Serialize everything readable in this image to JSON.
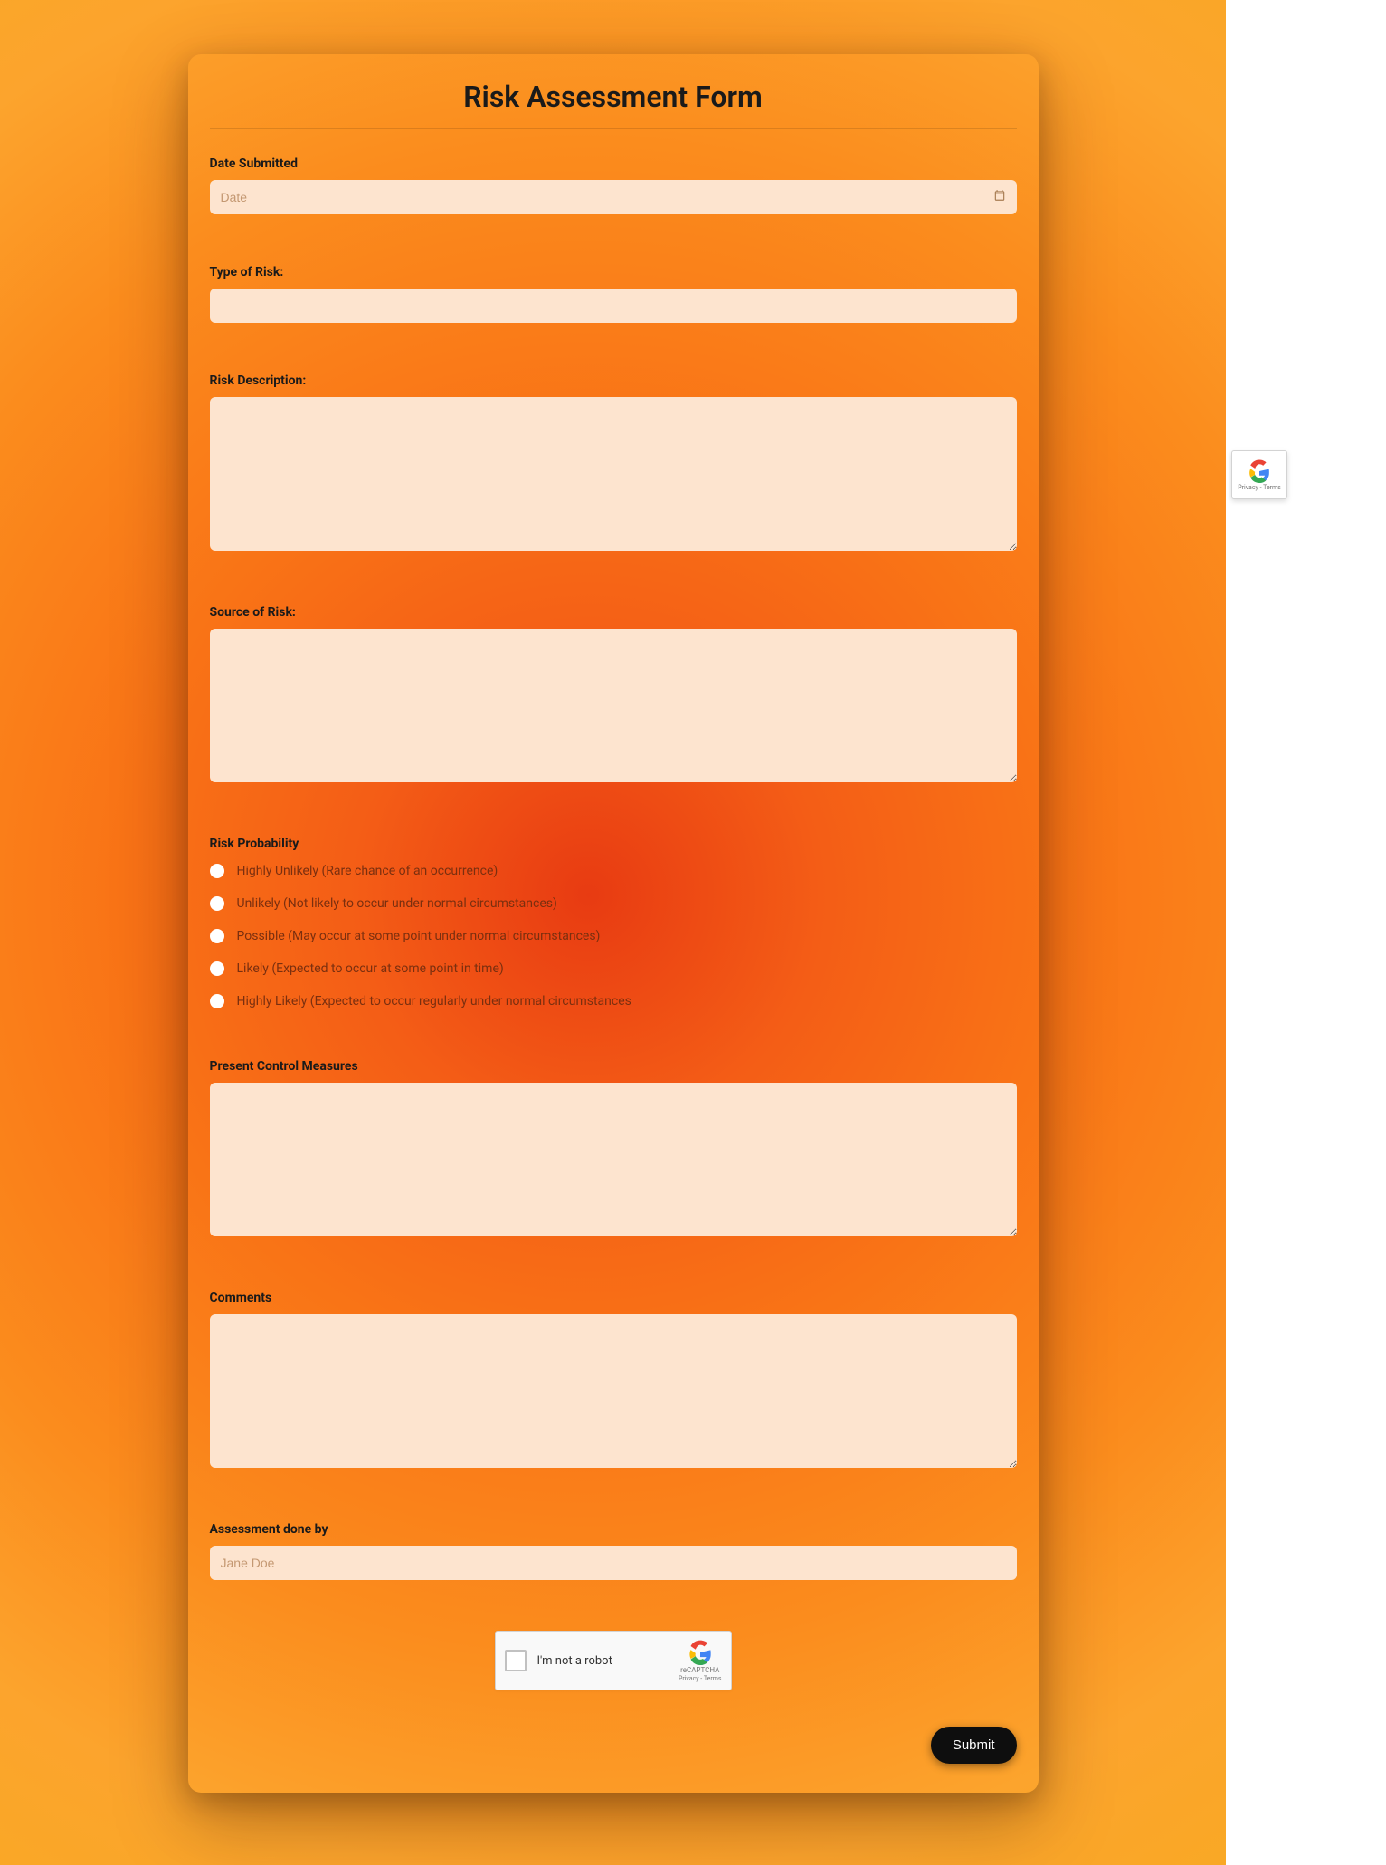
{
  "form": {
    "title": "Risk Assessment Form",
    "fields": {
      "date": {
        "label": "Date Submitted",
        "placeholder": "Date"
      },
      "type_of_risk": {
        "label": "Type of Risk:"
      },
      "risk_description": {
        "label": "Risk Description:"
      },
      "source_of_risk": {
        "label": "Source of Risk:"
      },
      "risk_probability": {
        "label": "Risk Probability",
        "options": [
          "Highly Unlikely (Rare chance of an occurrence)",
          "Unlikely (Not likely to occur under normal circumstances)",
          "Possible (May occur at some point under normal circumstances)",
          "Likely (Expected to occur at some point in time)",
          "Highly Likely (Expected to occur regularly under normal circumstances"
        ]
      },
      "control_measures": {
        "label": "Present Control Measures"
      },
      "comments": {
        "label": "Comments"
      },
      "done_by": {
        "label": "Assessment done by",
        "placeholder": "Jane Doe"
      }
    },
    "recaptcha": {
      "text": "I'm not a robot",
      "brand": "reCAPTCHA",
      "links": "Privacy - Terms"
    },
    "submit_label": "Submit"
  }
}
